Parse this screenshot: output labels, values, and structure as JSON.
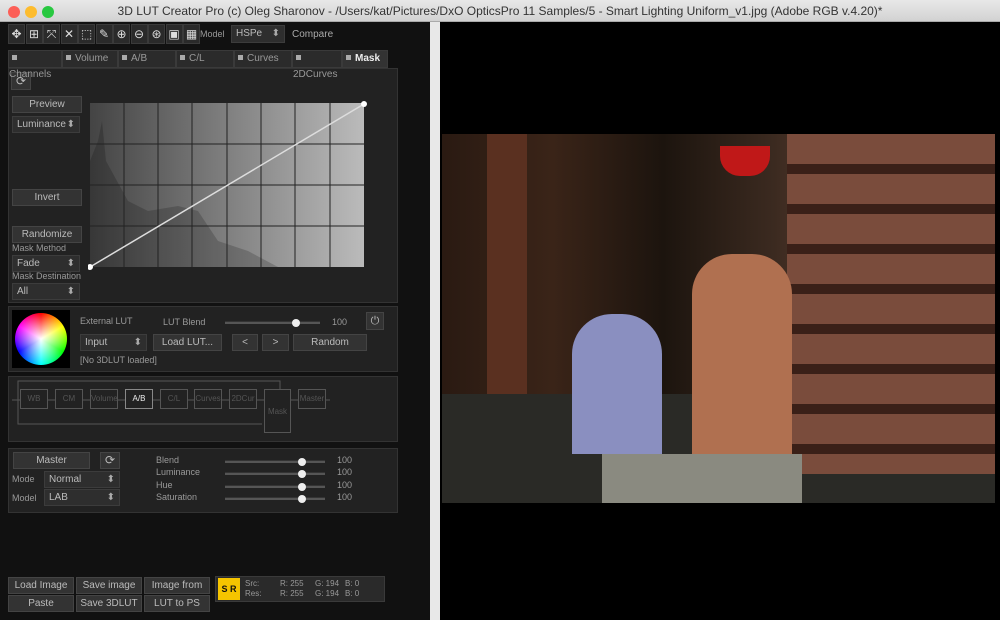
{
  "window": {
    "title": "3D LUT Creator Pro (c) Oleg Sharonov - /Users/kat/Pictures/DxO OpticsPro 11 Samples/5 - Smart Lighting Uniform_v1.jpg (Adobe RGB v.4.20)*"
  },
  "toolbar": {
    "tools": [
      "move-icon",
      "grid-icon",
      "expand-icon",
      "collapse-icon",
      "select-rect-icon",
      "eyedropper-icon",
      "zoom-in-icon",
      "zoom-out-icon",
      "zoom-fit-icon",
      "frame-icon",
      "grid-dots-icon"
    ],
    "model_label": "Model",
    "model_value": "HSPe",
    "compare_label": "Compare"
  },
  "tabs": [
    "Channels",
    "Volume",
    "A/B",
    "C/L",
    "Curves",
    "2DCurves",
    "Mask"
  ],
  "active_tab": "Mask",
  "mask": {
    "preview": "Preview",
    "channel": "Luminance",
    "invert": "Invert",
    "randomize": "Randomize",
    "method_label": "Mask Method",
    "method": "Fade",
    "dest_label": "Mask Destination",
    "dest": "All"
  },
  "lut": {
    "external_label": "External LUT",
    "blend_label": "LUT Blend",
    "blend_value": "100",
    "blend": 100,
    "input": "Input",
    "load": "Load LUT...",
    "prev": "<",
    "next": ">",
    "random": "Random",
    "status": "[No 3DLUT loaded]"
  },
  "flow": {
    "nodes": [
      "WB",
      "CM",
      "Volume",
      "A/B",
      "C/L",
      "Curves",
      "2DCur",
      "Mask",
      "Master"
    ],
    "active": "A/B"
  },
  "master": {
    "button": "Master",
    "mode_label": "Mode",
    "mode": "Normal",
    "model_label": "Model",
    "model": "LAB",
    "sliders": [
      {
        "label": "Blend",
        "value": "100"
      },
      {
        "label": "Luminance",
        "value": "100"
      },
      {
        "label": "Hue",
        "value": "100"
      },
      {
        "label": "Saturation",
        "value": "100"
      }
    ]
  },
  "bottom": {
    "buttons": [
      "Load Image",
      "Save image",
      "Image from PS",
      "Paste",
      "Save 3DLUT",
      "LUT to PS"
    ],
    "s": "S",
    "r": "R",
    "src_label": "Src:",
    "res_label": "Res:",
    "src": {
      "r": "R: 255",
      "g": "G: 194",
      "b": "B:   0"
    },
    "res": {
      "r": "R: 255",
      "g": "G: 194",
      "b": "B:   0"
    },
    "accent": "#f5c400"
  }
}
